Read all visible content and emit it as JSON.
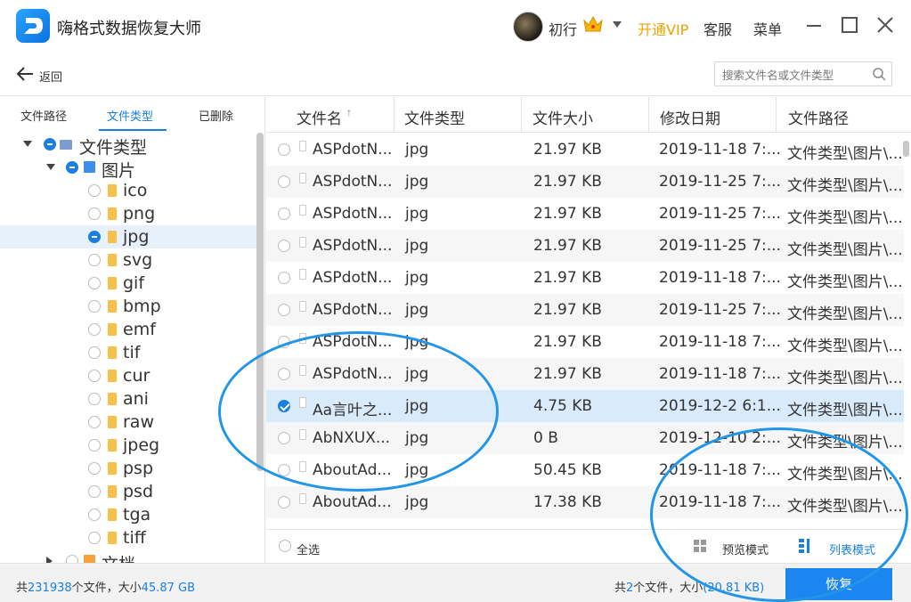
{
  "app": {
    "title": "嗨格式数据恢复大师"
  },
  "user": {
    "name": "初行"
  },
  "header": {
    "vip_label": "开通VIP",
    "service_label": "客服",
    "menu_label": "菜单"
  },
  "toolbar": {
    "back_label": "返回",
    "search_placeholder": "搜索文件名或文件类型"
  },
  "tabs": [
    {
      "label": "文件路径",
      "active": false
    },
    {
      "label": "文件类型",
      "active": true
    },
    {
      "label": "已删除",
      "active": false
    }
  ],
  "tree": [
    {
      "label": "文件类型",
      "level": 0,
      "expanded": true,
      "check": "partial"
    },
    {
      "label": "图片",
      "level": 1,
      "expanded": true,
      "check": "partial"
    },
    {
      "label": "ico",
      "level": 2,
      "check": "none"
    },
    {
      "label": "png",
      "level": 2,
      "check": "none"
    },
    {
      "label": "jpg",
      "level": 2,
      "check": "partial",
      "selected": true
    },
    {
      "label": "svg",
      "level": 2,
      "check": "none"
    },
    {
      "label": "gif",
      "level": 2,
      "check": "none"
    },
    {
      "label": "bmp",
      "level": 2,
      "check": "none"
    },
    {
      "label": "emf",
      "level": 2,
      "check": "none"
    },
    {
      "label": "tif",
      "level": 2,
      "check": "none"
    },
    {
      "label": "cur",
      "level": 2,
      "check": "none"
    },
    {
      "label": "ani",
      "level": 2,
      "check": "none"
    },
    {
      "label": "raw",
      "level": 2,
      "check": "none"
    },
    {
      "label": "jpeg",
      "level": 2,
      "check": "none"
    },
    {
      "label": "psp",
      "level": 2,
      "check": "none"
    },
    {
      "label": "psd",
      "level": 2,
      "check": "none"
    },
    {
      "label": "tga",
      "level": 2,
      "check": "none"
    },
    {
      "label": "tiff",
      "level": 2,
      "check": "none"
    },
    {
      "label": "文档",
      "level": 1,
      "expanded": false,
      "check": "none"
    }
  ],
  "table": {
    "columns": [
      "文件名",
      "文件类型",
      "文件大小",
      "修改日期",
      "文件路径"
    ],
    "rows": [
      {
        "name": "ASPdotN...",
        "type": "jpg",
        "size": "21.97 KB",
        "date": "2019-11-18 7:...",
        "path": "文件类型\\图片\\...",
        "checked": false
      },
      {
        "name": "ASPdotN...",
        "type": "jpg",
        "size": "21.97 KB",
        "date": "2019-11-25 7:...",
        "path": "文件类型\\图片\\...",
        "checked": false
      },
      {
        "name": "ASPdotN...",
        "type": "jpg",
        "size": "21.97 KB",
        "date": "2019-11-25 7:...",
        "path": "文件类型\\图片\\...",
        "checked": false
      },
      {
        "name": "ASPdotN...",
        "type": "jpg",
        "size": "21.97 KB",
        "date": "2019-11-25 7:...",
        "path": "文件类型\\图片\\...",
        "checked": false
      },
      {
        "name": "ASPdotN...",
        "type": "jpg",
        "size": "21.97 KB",
        "date": "2019-11-18 7:...",
        "path": "文件类型\\图片\\...",
        "checked": false
      },
      {
        "name": "ASPdotN...",
        "type": "jpg",
        "size": "21.97 KB",
        "date": "2019-11-25 7:...",
        "path": "文件类型\\图片\\...",
        "checked": false
      },
      {
        "name": "ASPdotN...",
        "type": "jpg",
        "size": "21.97 KB",
        "date": "2019-11-18 7:...",
        "path": "文件类型\\图片\\...",
        "checked": false
      },
      {
        "name": "ASPdotN...",
        "type": "jpg",
        "size": "21.97 KB",
        "date": "2019-11-18 7:...",
        "path": "文件类型\\图片\\...",
        "checked": false
      },
      {
        "name": "Aa言叶之...",
        "type": "jpg",
        "size": "4.75 KB",
        "date": "2019-12-2 6:1...",
        "path": "文件类型\\图片\\...",
        "checked": true
      },
      {
        "name": "AbNXUX...",
        "type": "jpg",
        "size": "0 B",
        "date": "2019-12-10 2:...",
        "path": "文件类型\\图片\\...",
        "checked": false
      },
      {
        "name": "AboutAd...",
        "type": "jpg",
        "size": "50.45 KB",
        "date": "2019-11-18 7:...",
        "path": "文件类型\\图片\\...",
        "checked": false
      },
      {
        "name": "AboutAd...",
        "type": "jpg",
        "size": "17.38 KB",
        "date": "2019-11-18 7:...",
        "path": "文件类型\\图片\\...",
        "checked": false
      }
    ]
  },
  "list_footer": {
    "select_all_label": "全选",
    "preview_mode_label": "预览模式",
    "list_mode_label": "列表模式"
  },
  "status": {
    "total_prefix": "共",
    "total_count": "231938",
    "total_mid": "个文件，大小",
    "total_size": "45.87 GB",
    "sel_prefix": "共",
    "sel_count": "2",
    "sel_mid": "个文件，大小",
    "sel_size": "(20.81 KB)",
    "recover_label": "恢复"
  },
  "colors": {
    "accent": "#1b7fe0",
    "vip": "#e8a400",
    "annotation": "#2196e8"
  }
}
